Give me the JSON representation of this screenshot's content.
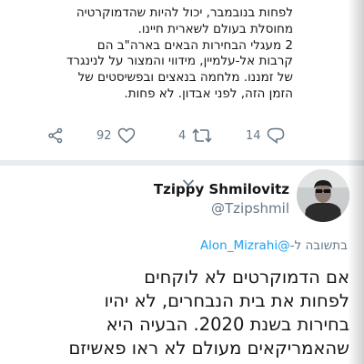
{
  "tweet1": {
    "text_lines": "לפחות בנובמבר, יכול להיות שהדמוקרטיה\nמחוסלת בעולם לשארית חיינו.\n2 מעגלי הבחירות הבאים בארה\"ב הם\nקרבות אל-עלמיין, מידווי והמצור על לנינגרד\nשל זמננו. מלחמה בנאצים ובפשיסטים של\nהזמן הזה, לפני אבדון. לא פחות.",
    "actions": {
      "share_icon": "share-icon",
      "like_icon": "heart-icon",
      "like_count": "92",
      "retweet_icon": "retweet-icon",
      "retweet_count": "4",
      "reply_icon": "reply-icon",
      "reply_count": "14"
    }
  },
  "tweet2": {
    "display_name": "Tzippy Shmilovitz",
    "handle": "@Tzipshmil",
    "reply_prefix": "בתשובה ל-",
    "reply_mention": "@Alon_Mizrahi",
    "text": "אם הדמוקרטים לא לוקחים\nלפחות את בית הנבחרים, לא יהיו\nבחירות בשנת 2020. הבעיה היא\nשהאמריקאים מעולם לא ראו פאשיזם",
    "avatar_icon": "avatar",
    "chevron_icon": "chevron-down-icon"
  },
  "colors": {
    "text": "#14171a",
    "secondary": "#657786",
    "link": "#1da1f2",
    "divider": "#e6ecf0"
  }
}
